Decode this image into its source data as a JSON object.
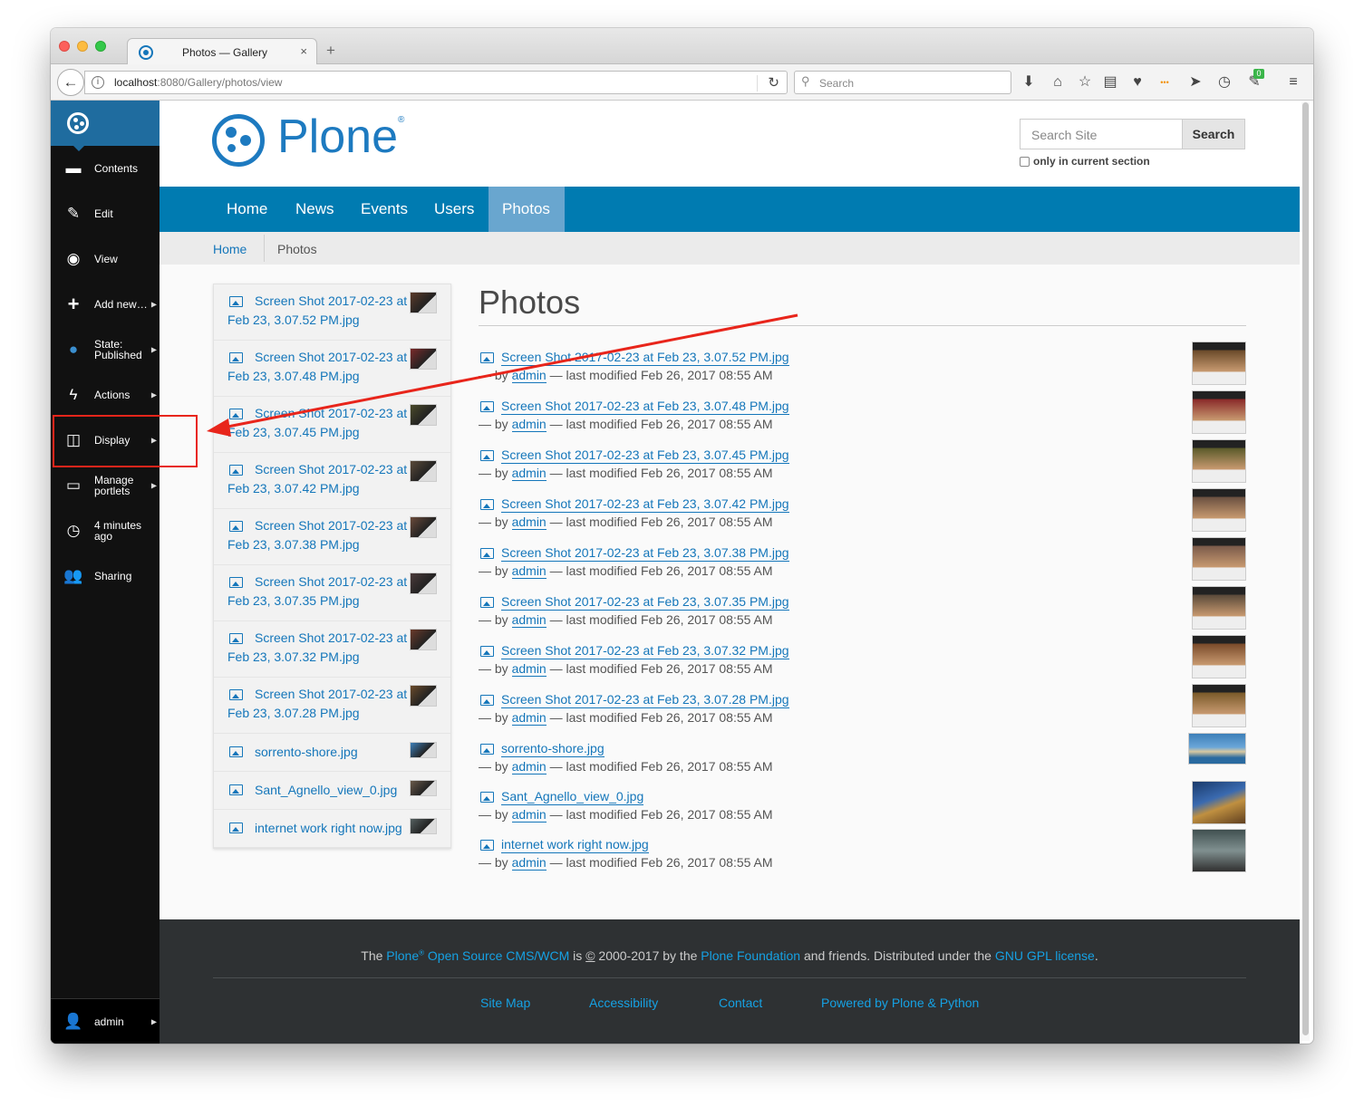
{
  "browser": {
    "tab_title": "Photos — Gallery",
    "tab_close": "×",
    "new_tab": "+",
    "url_host": "localhost",
    "url_rest": ":8080/Gallery/photos/view",
    "search_placeholder": "Search",
    "badge_count": "0"
  },
  "toolbar": {
    "items": [
      {
        "label": "Contents",
        "icon": "folder-icon"
      },
      {
        "label": "Edit",
        "icon": "pencil-icon"
      },
      {
        "label": "View",
        "icon": "eye-icon"
      },
      {
        "label": "Add new…",
        "icon": "plus-icon"
      },
      {
        "label": "State: Published",
        "line1": "State:",
        "line2": "Published",
        "icon": "globe-icon"
      },
      {
        "label": "Actions",
        "icon": "bolt-icon"
      },
      {
        "label": "Display",
        "icon": "display-icon"
      },
      {
        "label": "Manage portlets",
        "line1": "Manage",
        "line2": "portlets",
        "icon": "window-icon"
      },
      {
        "label": "4 minutes ago",
        "line1": "4 minutes",
        "line2": "ago",
        "icon": "clock-icon"
      },
      {
        "label": "Sharing",
        "icon": "users-icon"
      }
    ],
    "user": "admin"
  },
  "header": {
    "logo_text": "Plone",
    "logo_reg": "®",
    "search_placeholder": "Search Site",
    "search_button": "Search",
    "only_current": "only in current section"
  },
  "nav": {
    "items": [
      "Home",
      "News",
      "Events",
      "Users",
      "Photos"
    ],
    "active": "Photos"
  },
  "breadcrumbs": {
    "home": "Home",
    "current": "Photos"
  },
  "portlet": {
    "items": [
      {
        "line1": "Screen Shot 2017-02-23 at",
        "line2": "Feb 23, 3.07.52 PM.jpg"
      },
      {
        "line1": "Screen Shot 2017-02-23 at",
        "line2": "Feb 23, 3.07.48 PM.jpg"
      },
      {
        "line1": "Screen Shot 2017-02-23 at",
        "line2": "Feb 23, 3.07.45 PM.jpg"
      },
      {
        "line1": "Screen Shot 2017-02-23 at",
        "line2": "Feb 23, 3.07.42 PM.jpg"
      },
      {
        "line1": "Screen Shot 2017-02-23 at",
        "line2": "Feb 23, 3.07.38 PM.jpg"
      },
      {
        "line1": "Screen Shot 2017-02-23 at",
        "line2": "Feb 23, 3.07.35 PM.jpg"
      },
      {
        "line1": "Screen Shot 2017-02-23 at",
        "line2": "Feb 23, 3.07.32 PM.jpg"
      },
      {
        "line1": "Screen Shot 2017-02-23 at",
        "line2": "Feb 23, 3.07.28 PM.jpg"
      },
      {
        "line1": "sorrento-shore.jpg",
        "line2": ""
      },
      {
        "line1": "Sant_Agnello_view_0.jpg",
        "line2": ""
      },
      {
        "line1": "internet work right now.jpg",
        "line2": ""
      }
    ]
  },
  "content": {
    "title": "Photos",
    "byline_prefix": "— by",
    "author": "admin",
    "modified": "— last modified Feb 26, 2017 08:55 AM",
    "entries": [
      "Screen Shot 2017-02-23 at Feb 23, 3.07.52 PM.jpg",
      "Screen Shot 2017-02-23 at Feb 23, 3.07.48 PM.jpg",
      "Screen Shot 2017-02-23 at Feb 23, 3.07.45 PM.jpg",
      "Screen Shot 2017-02-23 at Feb 23, 3.07.42 PM.jpg",
      "Screen Shot 2017-02-23 at Feb 23, 3.07.38 PM.jpg",
      "Screen Shot 2017-02-23 at Feb 23, 3.07.35 PM.jpg",
      "Screen Shot 2017-02-23 at Feb 23, 3.07.32 PM.jpg",
      "Screen Shot 2017-02-23 at Feb 23, 3.07.28 PM.jpg",
      "sorrento-shore.jpg",
      "Sant_Agnello_view_0.jpg",
      "internet work right now.jpg"
    ]
  },
  "footer": {
    "the": "The",
    "plone": "Plone",
    "reg": "®",
    "cms": "Open Source CMS/WCM",
    "is": "is",
    "copy": "©",
    "years": "2000-2017 by the",
    "foundation": "Plone Foundation",
    "and": "and friends. Distributed under the",
    "license": "GNU GPL license",
    "dot": ".",
    "links": [
      "Site Map",
      "Accessibility",
      "Contact",
      "Powered by Plone & Python"
    ]
  },
  "colors": {
    "plone_blue": "#1d7ac0",
    "nav_blue": "#007bb1",
    "nav_active": "#69a6cf",
    "toolbar_bg": "#111111",
    "footer_bg": "#2e3133",
    "annotation_red": "#e8251b"
  }
}
